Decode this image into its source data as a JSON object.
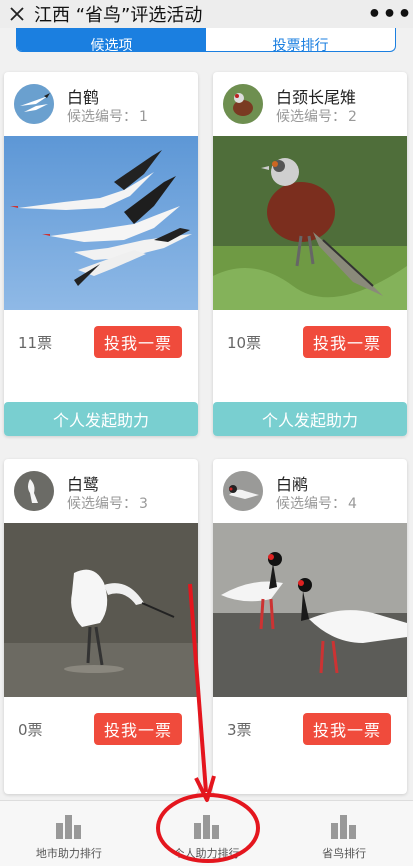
{
  "header": {
    "title": "江西 “省鸟”评选活动",
    "close_icon": "close-icon",
    "more_label": "•••"
  },
  "tabs": [
    {
      "label": "候选项",
      "active": true
    },
    {
      "label": "投票排行",
      "active": false
    }
  ],
  "cards": [
    {
      "name": "白鹤",
      "number_label": "候选编号：",
      "number": "1",
      "votes": "11票",
      "vote_label": "投我一票",
      "boost_label": "个人发起助力"
    },
    {
      "name": "白颈长尾雉",
      "number_label": "候选编号：",
      "number": "2",
      "votes": "10票",
      "vote_label": "投我一票",
      "boost_label": "个人发起助力"
    },
    {
      "name": "白鹭",
      "number_label": "候选编号：",
      "number": "3",
      "votes": "0票",
      "vote_label": "投我一票"
    },
    {
      "name": "白鹇",
      "number_label": "候选编号：",
      "number": "4",
      "votes": "3票",
      "vote_label": "投我一票"
    }
  ],
  "bottom_nav": [
    {
      "label": "地市助力排行",
      "icon": "bar-chart-icon"
    },
    {
      "label": "个人助力排行",
      "icon": "bar-chart-icon"
    },
    {
      "label": "省鸟排行",
      "icon": "bar-chart-icon"
    }
  ],
  "colors": {
    "accent_blue": "#1b7fe0",
    "vote_red": "#f04b3c",
    "boost_teal": "#79cfd0",
    "annotation_red": "#e4161e"
  }
}
